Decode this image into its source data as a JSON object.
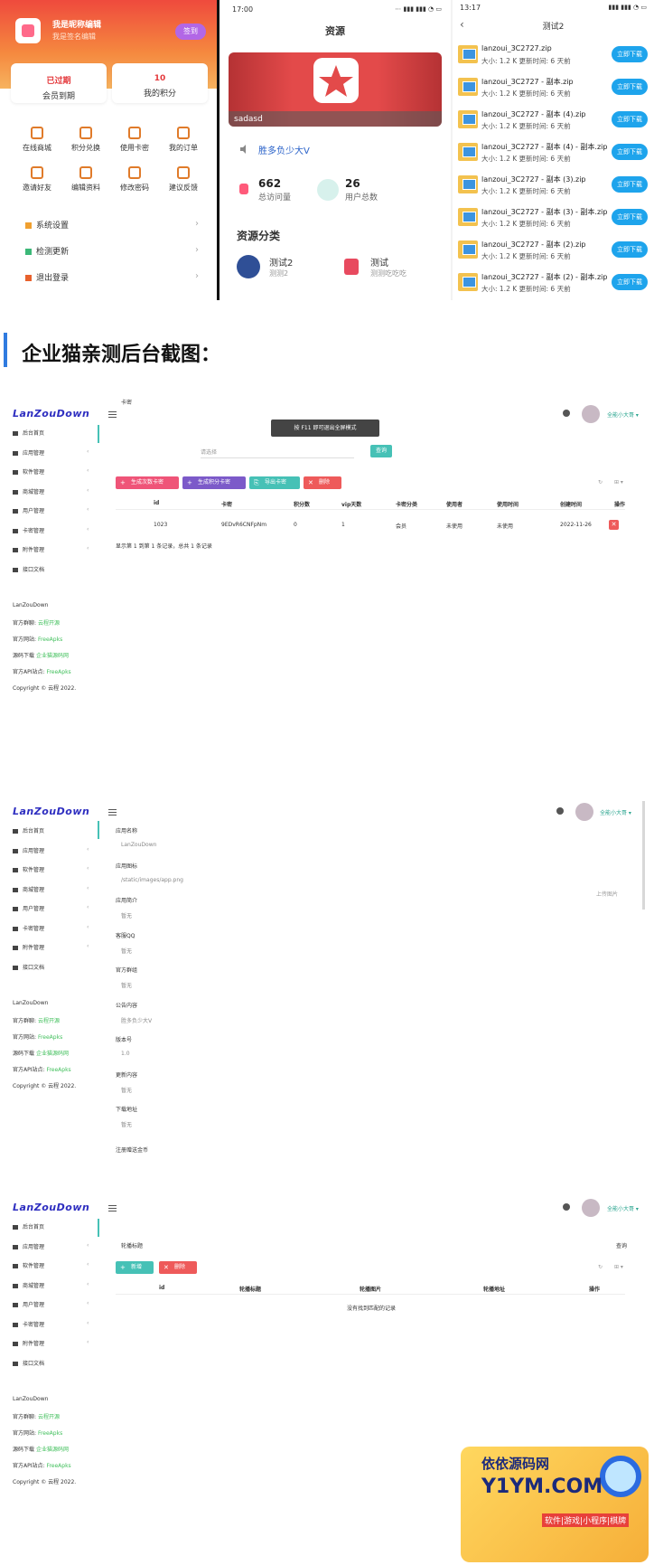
{
  "phoneA": {
    "nickname": "我是昵称编辑",
    "signature": "我是签名编辑",
    "sign_button": "签到",
    "card_left": {
      "value": "已过期",
      "label": "会员到期"
    },
    "card_right": {
      "value": "10",
      "label": "我的积分"
    },
    "grid_row1": [
      "在线商城",
      "积分兑换",
      "使用卡密",
      "我的订单"
    ],
    "grid_row2": [
      "邀请好友",
      "编辑资料",
      "修改密码",
      "建议反馈"
    ],
    "menu": [
      "系统设置",
      "检测更新",
      "退出登录"
    ]
  },
  "phoneB": {
    "time": "17:00",
    "status": "⋯ ▮▮▮ ▮▮▮ ◔ ▭",
    "title": "资源",
    "banner_caption": "sadasd",
    "notice": "胜多负少大V",
    "visits": {
      "value": "662",
      "label": "总访问量"
    },
    "users": {
      "value": "26",
      "label": "用户总数"
    },
    "category_title": "资源分类",
    "cats": [
      {
        "name": "测试2",
        "desc": "测测2"
      },
      {
        "name": "测试",
        "desc": "测测吃吃吃"
      }
    ]
  },
  "phoneC": {
    "time": "13:17",
    "status": "▮▮▮ ▮▮▮ ◔ ▭",
    "title": "测试2",
    "download_label": "立即下载",
    "files": [
      {
        "name": "lanzoui_3C2727.zip",
        "meta": "大小:  1.2 K  更新时间:  6 天前"
      },
      {
        "name": "lanzoui_3C2727 - 副本.zip",
        "meta": "大小:  1.2 K  更新时间:  6 天前"
      },
      {
        "name": "lanzoui_3C2727 - 副本 (4).zip",
        "meta": "大小:  1.2 K  更新时间:  6 天前"
      },
      {
        "name": "lanzoui_3C2727 - 副本 (4) - 副本.zip",
        "meta": "大小:  1.2 K  更新时间:  6 天前"
      },
      {
        "name": "lanzoui_3C2727 - 副本 (3).zip",
        "meta": "大小:  1.2 K  更新时间:  6 天前"
      },
      {
        "name": "lanzoui_3C2727 - 副本 (3) - 副本.zip",
        "meta": "大小:  1.2 K  更新时间:  6 天前"
      },
      {
        "name": "lanzoui_3C2727 - 副本 (2).zip",
        "meta": "大小:  1.2 K  更新时间:  6 天前"
      },
      {
        "name": "lanzoui_3C2727 - 副本 (2) - 副本.zip",
        "meta": "大小:  1.2 K  更新时间:  6 天前"
      }
    ]
  },
  "section_title": "企业猫亲测后台截图：",
  "admin": {
    "logo": "LanZouDown",
    "user": "全能小大哥 ▾",
    "sidebar": [
      "后台首页",
      "应用管理",
      "软件管理",
      "商城管理",
      "用户管理",
      "卡密管理",
      "附件管理",
      "接口文档"
    ],
    "footer": {
      "name": "LanZouDown",
      "group_label": "官方群聊:",
      "group_value": "云程开源",
      "site_label": "官方网站:",
      "site_value": "FreeApks",
      "src_label": "源码下载",
      "src_value": "企业猫源码网",
      "api_label": "官方API站点:",
      "api_value": "FreeApks",
      "copyright": "Copyright © 云程 2022."
    }
  },
  "admin1": {
    "tooltip": "按 F11 即可退出全屏模式",
    "filter_label": "卡密",
    "filter_select": "请选择",
    "query_button": "查询",
    "buttons": [
      "生成次数卡密",
      "生成积分卡密",
      "导出卡密",
      "删除"
    ],
    "columns": [
      "id",
      "卡密",
      "积分数",
      "vip天数",
      "卡密分类",
      "使用者",
      "使用时间",
      "创建时间",
      "操作"
    ],
    "row": [
      "1023",
      "9EDvR6CNFpNm",
      "0",
      "1",
      "会员",
      "未使用",
      "未使用",
      "2022-11-26"
    ],
    "summary": "显示第 1 到第 1 条记录，总共 1 条记录"
  },
  "admin2": {
    "fields": [
      {
        "label": "应用名称",
        "value": "LanZouDown"
      },
      {
        "label": "应用图标",
        "value": "/static/images/app.png"
      },
      {
        "label": "应用简介",
        "value": "暂无"
      },
      {
        "label": "客服QQ",
        "value": "暂无"
      },
      {
        "label": "官方群组",
        "value": "暂无"
      },
      {
        "label": "公告内容",
        "value": "胜多负少大V"
      },
      {
        "label": "版本号",
        "value": "1.0"
      },
      {
        "label": "更新内容",
        "value": "暂无"
      },
      {
        "label": "下载地址",
        "value": "暂无"
      }
    ],
    "upload": "上传图片",
    "last_label": "注册赠送金币"
  },
  "admin3": {
    "filter_label": "轮播标题",
    "query": "查询",
    "buttons": [
      "新增",
      "删除"
    ],
    "columns": [
      "id",
      "轮播标题",
      "轮播图片",
      "轮播地址",
      "操作"
    ],
    "empty": "没有找到匹配的记录"
  },
  "watermark": {
    "line1": "依依源码网",
    "line2": "Y1YM.COM",
    "line3": "软件|游戏|小程序|棋牌"
  }
}
